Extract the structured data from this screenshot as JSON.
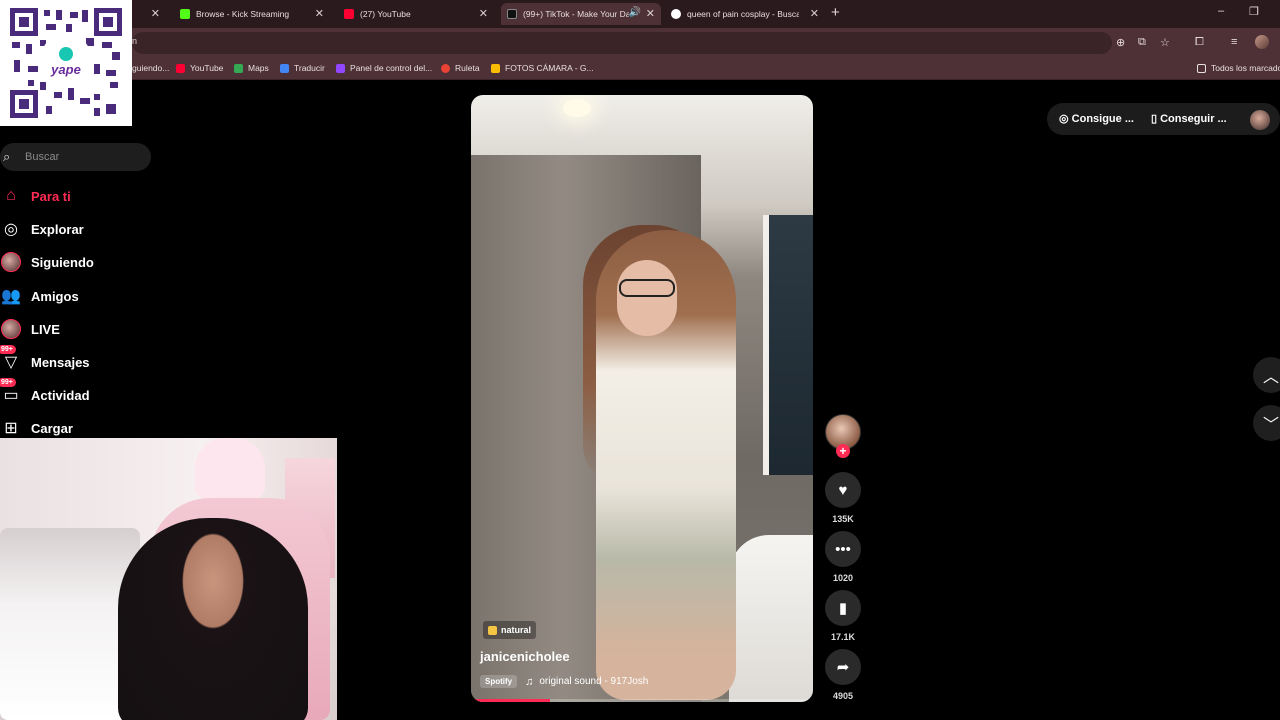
{
  "browser": {
    "tabs": [
      {
        "title": "",
        "favicon_color": "#6b6b6b"
      },
      {
        "title": "Browse - Kick Streaming",
        "favicon_color": "#53fc18"
      },
      {
        "title": "(27) YouTube",
        "favicon_color": "#ff0033"
      },
      {
        "title": "(99+) TikTok - Make Your Da",
        "favicon_color": "#111111",
        "active": true
      },
      {
        "title": "queen of pain cosplay - Buscar",
        "favicon_color": "#ffffff"
      }
    ],
    "new_tab": "+",
    "window_controls": {
      "minimize": "–",
      "restore": "❐"
    },
    "address_text": "n",
    "bookmarks": [
      {
        "label": "guiendo...",
        "color": "#a64dff"
      },
      {
        "label": "YouTube",
        "color": "#ff0033"
      },
      {
        "label": "Maps",
        "color": "#34a853"
      },
      {
        "label": "Traducir",
        "color": "#4285f4"
      },
      {
        "label": "Panel de control del...",
        "color": "#9146ff"
      },
      {
        "label": "Ruleta",
        "color": "#ea4335"
      },
      {
        "label": "FOTOS CÁMARA - G...",
        "color": "#fbbc04"
      }
    ],
    "bookmarks_all": "Todos los marcadores"
  },
  "qr": {
    "brand": "yape"
  },
  "sidebar": {
    "search_placeholder": "Buscar",
    "items": [
      {
        "label": "Para ti",
        "icon": "home-icon",
        "active": true
      },
      {
        "label": "Explorar",
        "icon": "compass-icon"
      },
      {
        "label": "Siguiendo",
        "icon": "avatar"
      },
      {
        "label": "Amigos",
        "icon": "friends-icon"
      },
      {
        "label": "LIVE",
        "icon": "avatar"
      },
      {
        "label": "Mensajes",
        "icon": "message-icon",
        "badge": "99+"
      },
      {
        "label": "Actividad",
        "icon": "inbox-icon",
        "badge": "99+"
      },
      {
        "label": "Cargar",
        "icon": "upload-icon"
      }
    ]
  },
  "video": {
    "tag": "natural",
    "author": "janicenicholee",
    "spotify": "Spotify",
    "sound": "original sound - 917Josh",
    "progress": 0.23
  },
  "actions": {
    "likes": "135K",
    "comments": "1020",
    "saves": "17.1K",
    "shares": "4905"
  },
  "top_right": {
    "coins": "Consigue ...",
    "app": "Conseguir ..."
  }
}
